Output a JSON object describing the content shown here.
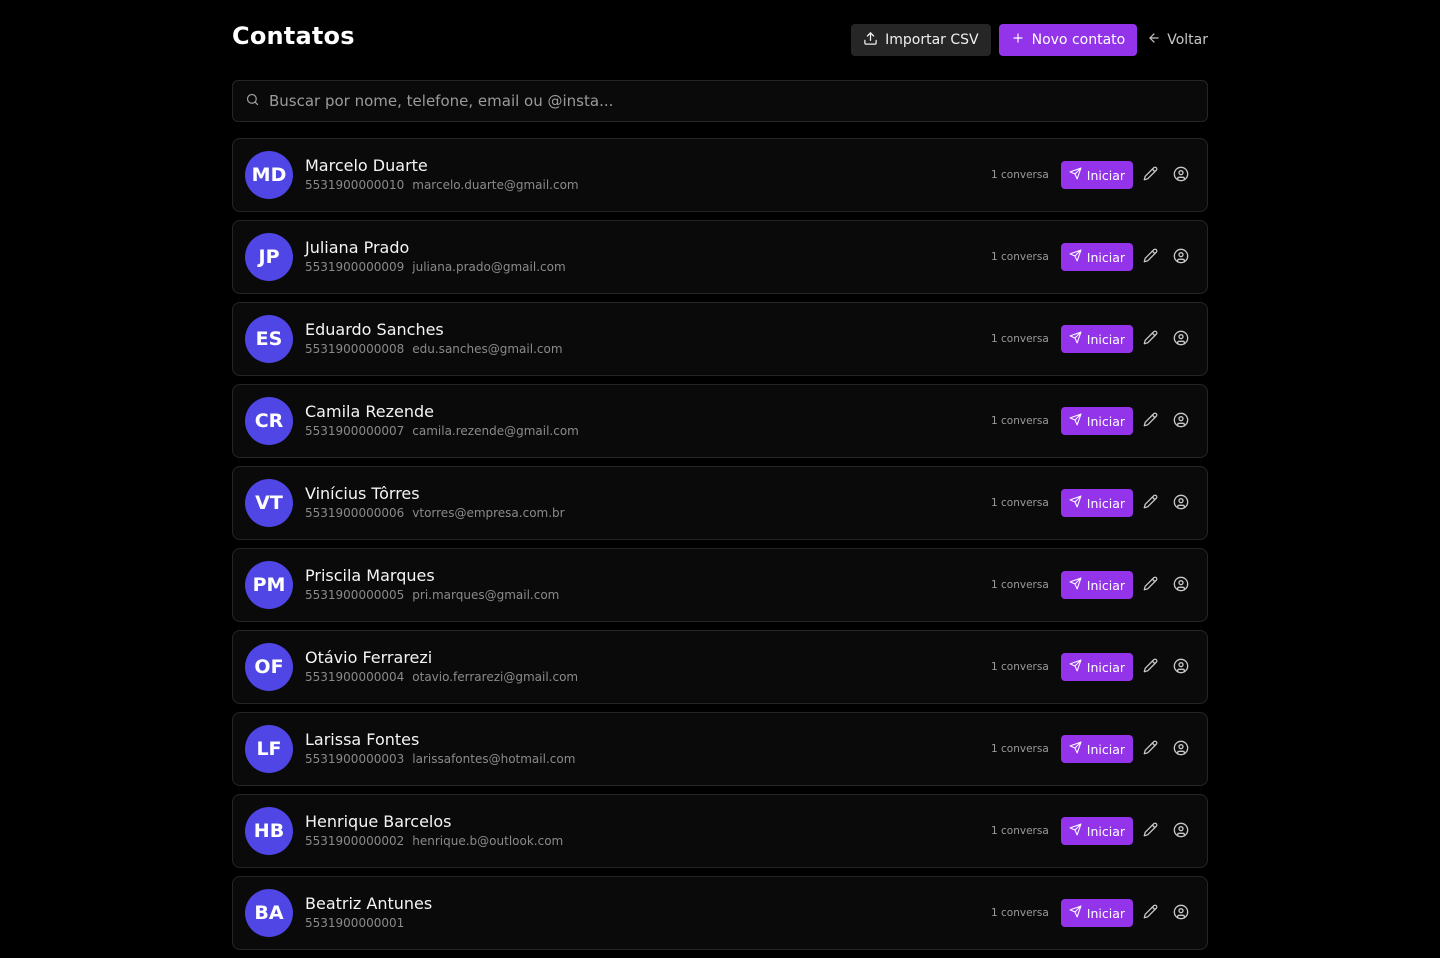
{
  "header": {
    "title": "Contatos",
    "import_label": "Importar CSV",
    "new_label": "Novo contato",
    "back_label": "Voltar"
  },
  "search": {
    "placeholder": "Buscar por nome, telefone, email ou @insta...",
    "icon": "search-icon"
  },
  "row_actions": {
    "start_label": "Iniciar",
    "start_icon": "send-icon",
    "edit_icon": "pencil-icon",
    "profile_icon": "user-circle-icon"
  },
  "colors": {
    "accent": "#9333ea",
    "avatar": "#4f46e5",
    "background": "#000000",
    "card": "#0a0a0a",
    "border": "#262626"
  },
  "contacts": [
    {
      "initials": "MD",
      "name": "Marcelo Duarte",
      "phone": "5531900000010",
      "email": "marcelo.duarte@gmail.com",
      "conversations": "1 conversa"
    },
    {
      "initials": "JP",
      "name": "Juliana Prado",
      "phone": "5531900000009",
      "email": "juliana.prado@gmail.com",
      "conversations": "1 conversa"
    },
    {
      "initials": "ES",
      "name": "Eduardo Sanches",
      "phone": "5531900000008",
      "email": "edu.sanches@gmail.com",
      "conversations": "1 conversa"
    },
    {
      "initials": "CR",
      "name": "Camila Rezende",
      "phone": "5531900000007",
      "email": "camila.rezende@gmail.com",
      "conversations": "1 conversa"
    },
    {
      "initials": "VT",
      "name": "Vinícius Tôrres",
      "phone": "5531900000006",
      "email": "vtorres@empresa.com.br",
      "conversations": "1 conversa"
    },
    {
      "initials": "PM",
      "name": "Priscila Marques",
      "phone": "5531900000005",
      "email": "pri.marques@gmail.com",
      "conversations": "1 conversa"
    },
    {
      "initials": "OF",
      "name": "Otávio Ferrarezi",
      "phone": "5531900000004",
      "email": "otavio.ferrarezi@gmail.com",
      "conversations": "1 conversa"
    },
    {
      "initials": "LF",
      "name": "Larissa Fontes",
      "phone": "5531900000003",
      "email": "larissafontes@hotmail.com",
      "conversations": "1 conversa"
    },
    {
      "initials": "HB",
      "name": "Henrique Barcelos",
      "phone": "5531900000002",
      "email": "henrique.b@outlook.com",
      "conversations": "1 conversa"
    },
    {
      "initials": "BA",
      "name": "Beatriz Antunes",
      "phone": "5531900000001",
      "email": "",
      "conversations": "1 conversa"
    }
  ]
}
